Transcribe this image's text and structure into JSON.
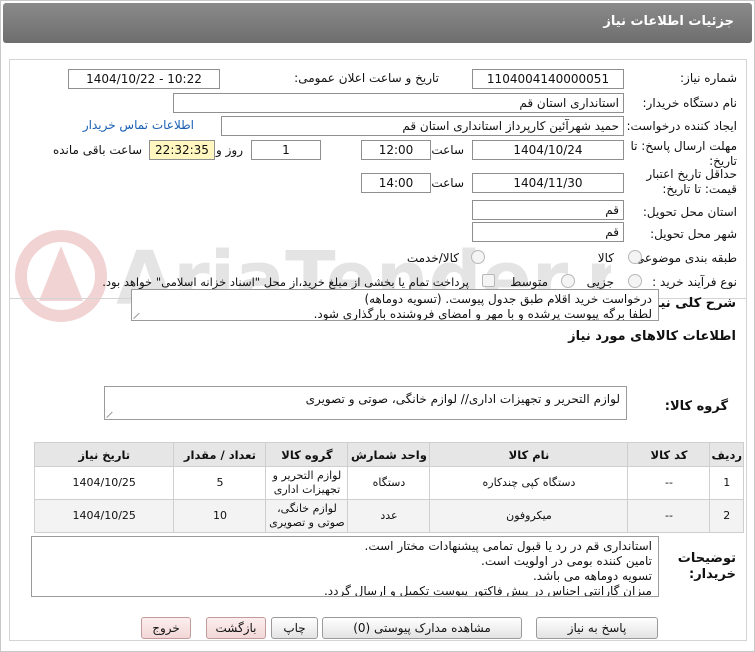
{
  "header": {
    "title": "جزئیات اطلاعات نیاز"
  },
  "fields": {
    "need_number_label": "شماره نیاز:",
    "need_number": "1104004140000051",
    "announce_label": "تاریخ و ساعت اعلان عمومی:",
    "announce_value": "1404/10/22 - 10:22",
    "buyer_org_label": "نام دستگاه خریدار:",
    "buyer_org": "استانداری استان قم",
    "creator_label": "ایجاد کننده درخواست:",
    "creator": "حمید شهرآئین کارپرداز استانداری استان قم",
    "contact_link": "اطلاعات تماس خریدار",
    "deadline_label_1": "مهلت ارسال پاسخ: تا",
    "deadline_label_2": "تاریخ:",
    "deadline_date": "1404/10/24",
    "time_label": "ساعت",
    "deadline_time": "12:00",
    "days_value": "1",
    "days_label": "روز و",
    "remaining_time": "22:32:35",
    "remaining_label": "ساعت باقی مانده",
    "validity_label_1": "حداقل تاریخ اعتبار",
    "validity_label_2": "قیمت: تا تاریخ:",
    "validity_date": "1404/11/30",
    "validity_time": "14:00",
    "province_label": "استان محل تحویل:",
    "province": "قم",
    "city_label": "شهر محل تحویل:",
    "city": "قم",
    "category_label": "طبقه بندی موضوعی:",
    "category_options": [
      "کالا",
      "کالا/خدمت"
    ],
    "process_label": "نوع فرآیند خرید :",
    "process_options": [
      "جزیی",
      "متوسط"
    ],
    "payment_note": "پرداخت تمام یا بخشی از مبلغ خرید،از محل \"اسناد خزانه اسلامی\" خواهد بود."
  },
  "summary": {
    "label": "شرح کلی نیاز:",
    "lines": [
      "درخواست خرید اقلام طبق جدول پیوست. (تسویه دوماهه)",
      "لطفا برگه پیوست پرشده و با مهر و امضای فروشنده بارگذاری شود."
    ]
  },
  "goods_info": {
    "heading": "اطلاعات کالاهای مورد نیاز",
    "group_label": "گروه کالا:",
    "group_value": "لوازم التحریر و تجهیزات اداری// لوازم خانگی، صوتی و تصویری"
  },
  "table": {
    "headers": [
      "ردیف",
      "کد کالا",
      "نام کالا",
      "واحد شمارش",
      "گروه کالا",
      "تعداد / مقدار",
      "تاریخ نیاز"
    ],
    "rows": [
      {
        "row": "1",
        "code": "--",
        "name": "دستگاه کپی چندکاره",
        "unit": "دستگاه",
        "group": "لوازم التحریر و تجهیزات اداری",
        "qty": "5",
        "date": "1404/10/25"
      },
      {
        "row": "2",
        "code": "--",
        "name": "میکروفون",
        "unit": "عدد",
        "group": "لوازم خانگی، صوتی و تصویری",
        "qty": "10",
        "date": "1404/10/25"
      }
    ]
  },
  "buyer_notes": {
    "label": "توضیحات خریدار:",
    "lines": [
      "استانداری قم در رد یا قبول تمامی پیشنهادات مختار است.",
      "تامین کننده بومی در اولویت است.",
      "تسویه دوماهه می باشد.",
      "میزان گارانتی اجناس در پیش فاکتور پیوست تکمیل و ارسال گردد."
    ]
  },
  "buttons": {
    "reply": "پاسخ به نیاز",
    "attachments": "مشاهده مدارک پیوستی (0)",
    "print": "چاپ",
    "back": "بازگشت",
    "exit": "خروج"
  },
  "watermark": {
    "text": "AriaTender.neT"
  }
}
